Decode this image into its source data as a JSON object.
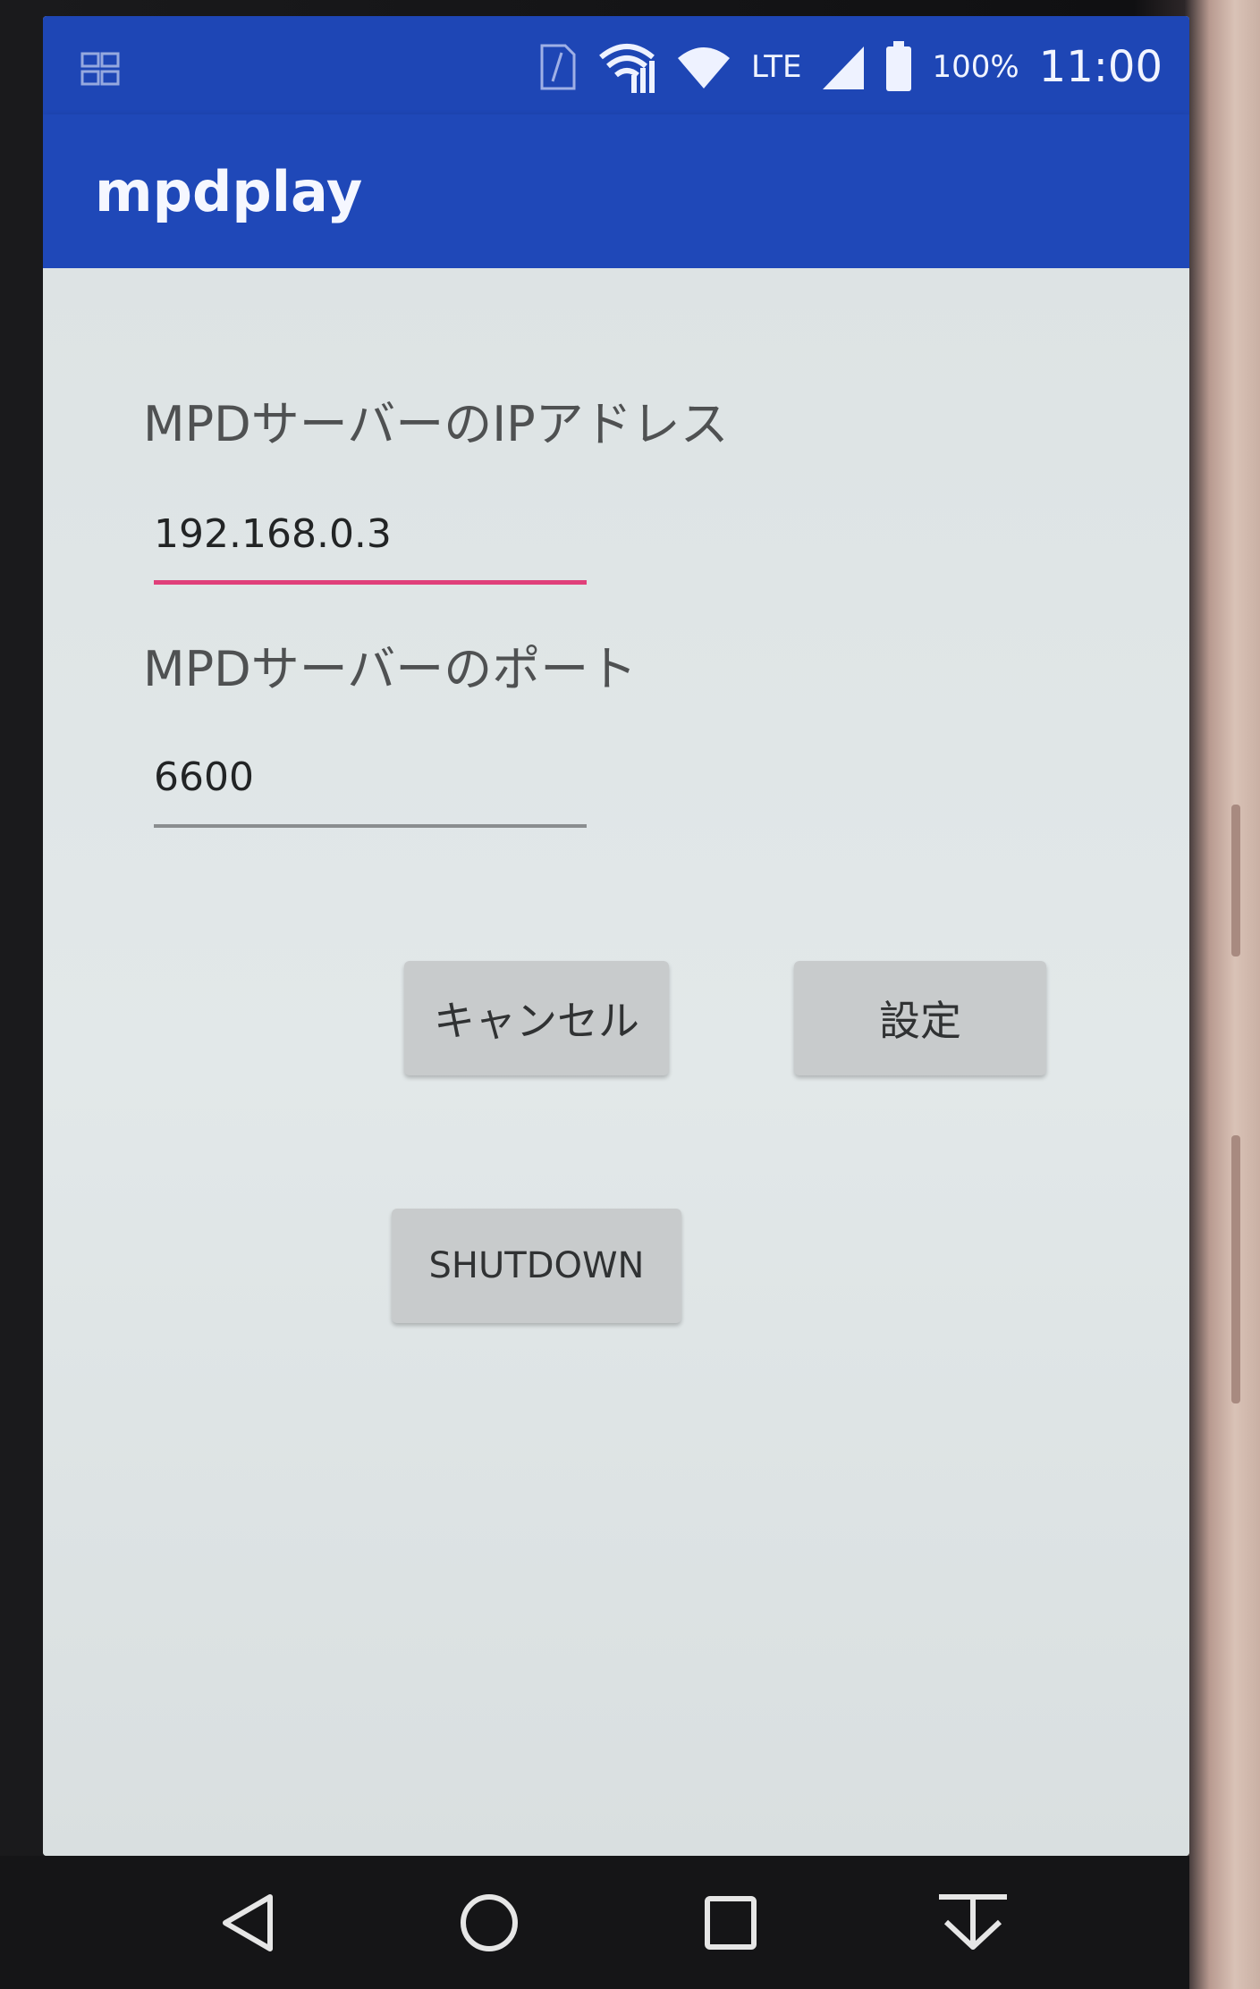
{
  "status_bar": {
    "battery": "100%",
    "time": "11:00",
    "network": "LTE",
    "icons": [
      "notification-icon",
      "sim-icon",
      "wifi-signal-icon",
      "wifi-icon",
      "lte-signal-icon",
      "battery-icon"
    ]
  },
  "app_bar": {
    "title": "mpdplay",
    "color": "#1f48b8"
  },
  "form": {
    "ip_label": "MPDサーバーのIPアドレス",
    "ip_value": "192.168.0.3",
    "port_label": "MPDサーバーのポート",
    "port_value": "6600",
    "focus_color": "#e0407a"
  },
  "buttons": {
    "cancel": "キャンセル",
    "set": "設定",
    "shutdown": "SHUTDOWN"
  },
  "nav_bar": {
    "icons": [
      "back-icon",
      "home-icon",
      "recents-icon",
      "hide-keyboard-icon"
    ]
  }
}
